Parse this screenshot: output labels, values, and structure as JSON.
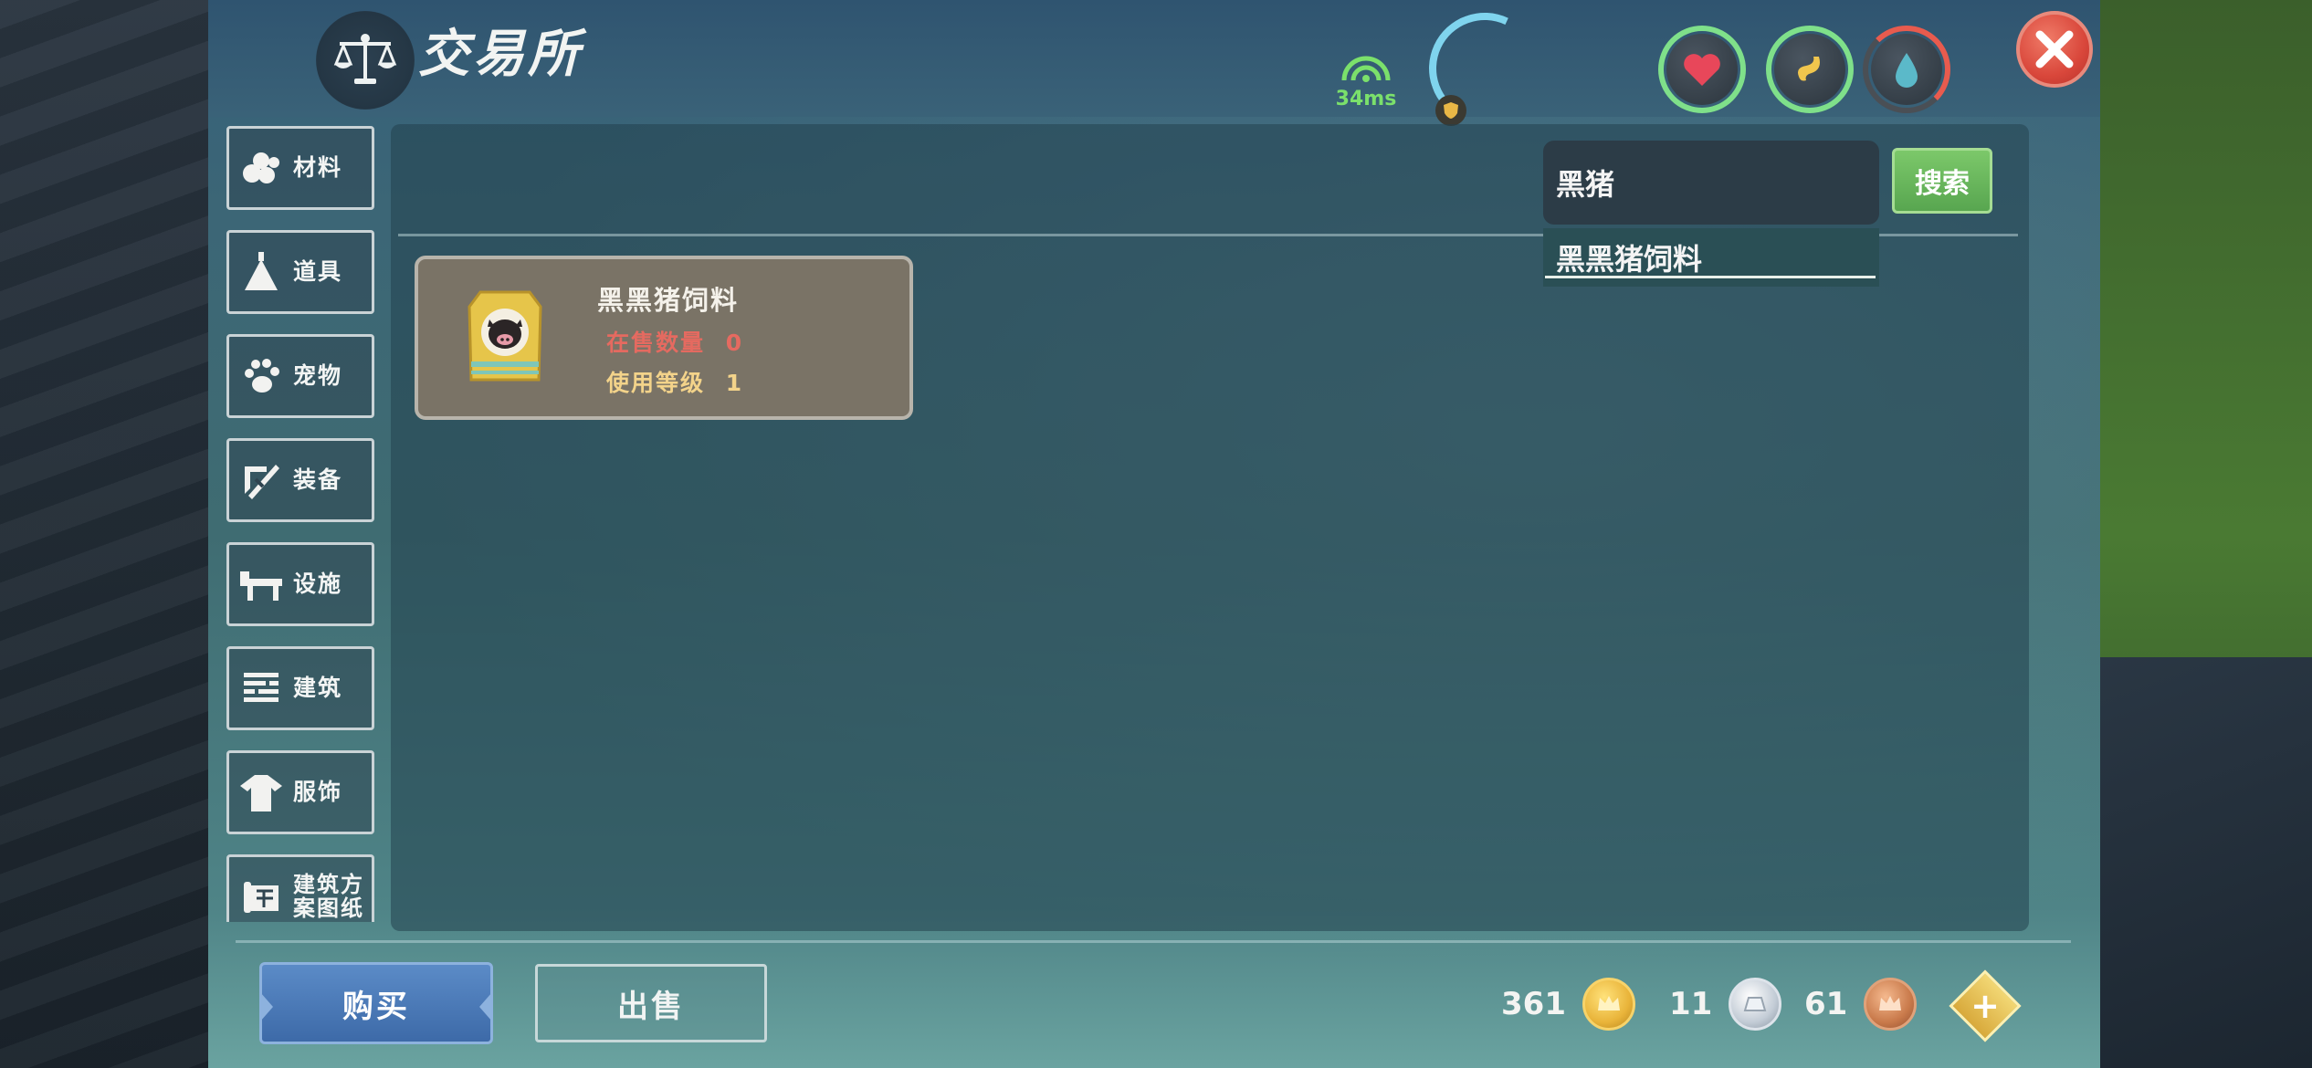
{
  "header": {
    "title": "交易所",
    "ping": "34ms"
  },
  "sidebar": {
    "items": [
      {
        "label": "材料",
        "icon": "materials-icon"
      },
      {
        "label": "道具",
        "icon": "tools-icon"
      },
      {
        "label": "宠物",
        "icon": "paw-icon"
      },
      {
        "label": "装备",
        "icon": "equipment-icon"
      },
      {
        "label": "设施",
        "icon": "facility-icon"
      },
      {
        "label": "建筑",
        "icon": "building-icon"
      },
      {
        "label": "服饰",
        "icon": "clothing-icon"
      },
      {
        "label": "建筑方案图纸",
        "label_line1": "建筑方",
        "label_line2": "案图纸",
        "icon": "blueprint-icon"
      }
    ]
  },
  "search": {
    "value": "黑猪",
    "button_label": "搜索",
    "suggestion": "黑黑猪饲料"
  },
  "items": [
    {
      "name": "黑黑猪饲料",
      "stock_label": "在售数量",
      "stock_value": "0",
      "level_label": "使用等级",
      "level_value": "1"
    }
  ],
  "footer": {
    "buy_label": "购买",
    "sell_label": "出售",
    "gold": "361",
    "silver": "11",
    "bronze": "61"
  },
  "colors": {
    "accent_green": "#58a650",
    "buy_blue": "#3d6aa8",
    "stock_red": "#e56a60",
    "level_gold": "#f3d38a",
    "close_red": "#d9473b"
  }
}
